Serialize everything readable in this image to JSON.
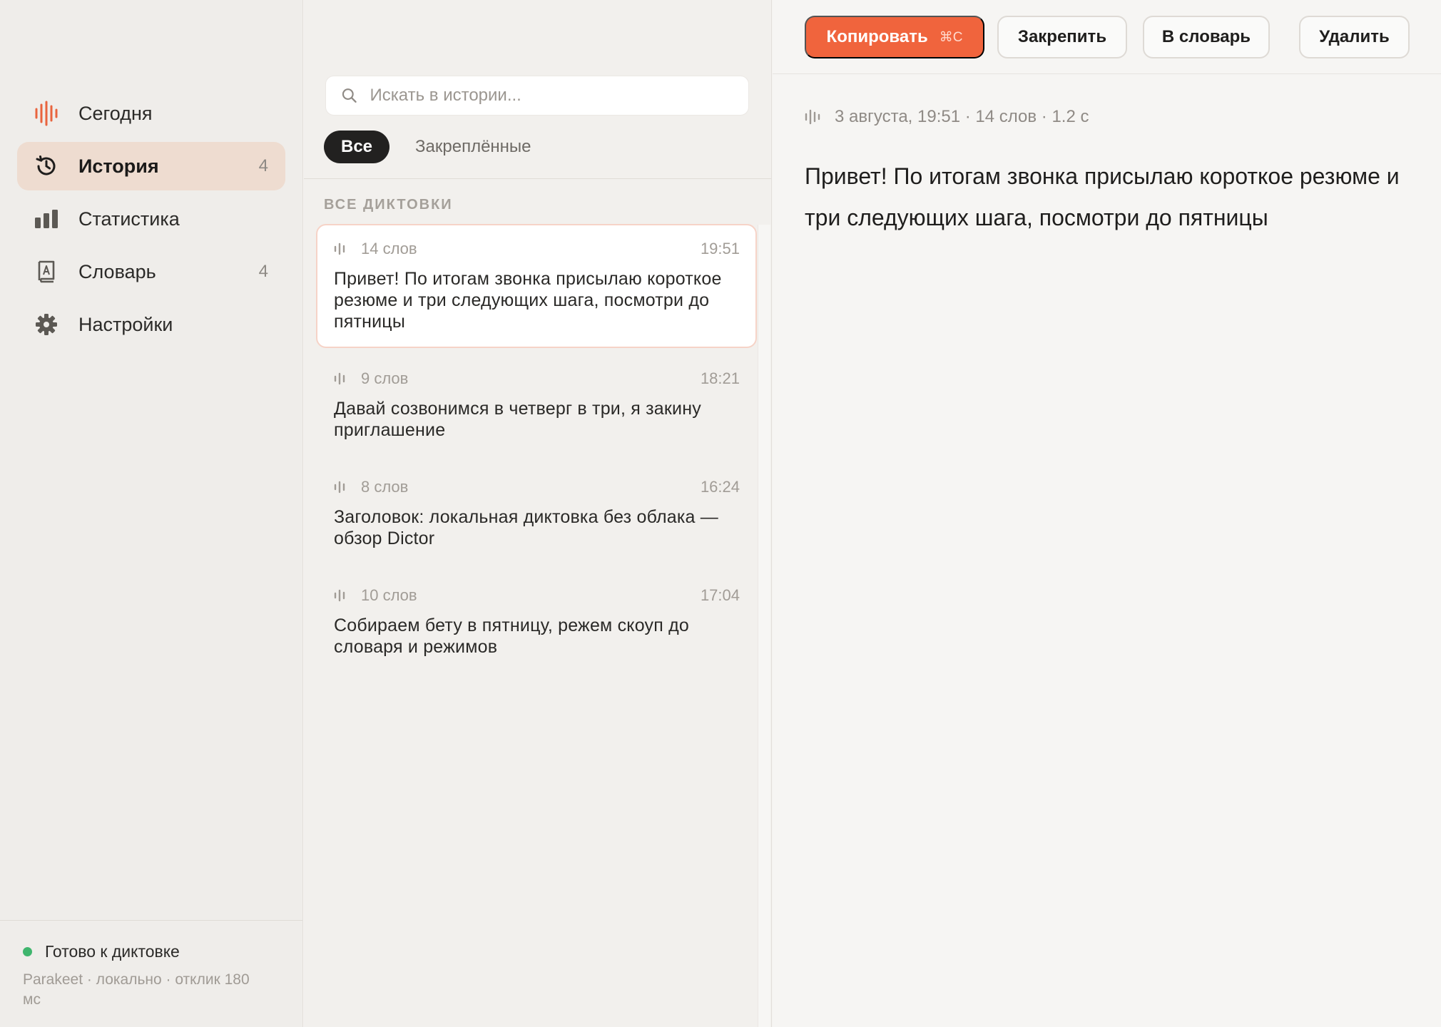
{
  "sidebar": {
    "items": [
      {
        "label": "Сегодня",
        "badge": "",
        "icon": "waveform-icon"
      },
      {
        "label": "История",
        "badge": "4",
        "icon": "history-clock-icon"
      },
      {
        "label": "Статистика",
        "badge": "",
        "icon": "bar-chart-icon"
      },
      {
        "label": "Словарь",
        "badge": "4",
        "icon": "dictionary-book-icon"
      },
      {
        "label": "Настройки",
        "badge": "",
        "icon": "gear-icon"
      }
    ],
    "active_index": 1,
    "status": "Готово к диктовке",
    "status_detail": "Parakeet · локально · отклик 180 мс"
  },
  "history": {
    "search_placeholder": "Искать в истории...",
    "filters": [
      "Все",
      "Закреплённые"
    ],
    "active_filter": 0,
    "section_title": "ВСЕ ДИКТОВКИ",
    "entries": [
      {
        "words": "14 слов",
        "time": "19:51",
        "text": "Привет! По итогам звонка присылаю короткое резюме и три следующих шага, посмотри до пятницы",
        "selected": true
      },
      {
        "words": "9 слов",
        "time": "18:21",
        "text": "Давай созвонимся в четверг в три, я закину приглашение",
        "selected": false
      },
      {
        "words": "8 слов",
        "time": "16:24",
        "text": "Заголовок: локальная диктовка без облака — обзор Dictor",
        "selected": false
      },
      {
        "words": "10 слов",
        "time": "17:04",
        "text": "Собираем бету в пятницу, режем скоуп до словаря и режимов",
        "selected": false
      }
    ]
  },
  "toolbar": {
    "copy_label": "Копировать",
    "copy_shortcut": "⌘C",
    "pin_label": "Закрепить",
    "dict_label": "В словарь",
    "delete_label": "Удалить"
  },
  "detail": {
    "meta": "3 августа, 19:51 · 14 слов · 1.2 с",
    "text": "Привет! По итогам звонка присылаю короткое резюме и три следующих шага, посмотри до пятницы"
  },
  "colors": {
    "accent": "#f0643d",
    "active_nav_bg": "#eedcd0",
    "status_ready": "#3fb56d"
  }
}
